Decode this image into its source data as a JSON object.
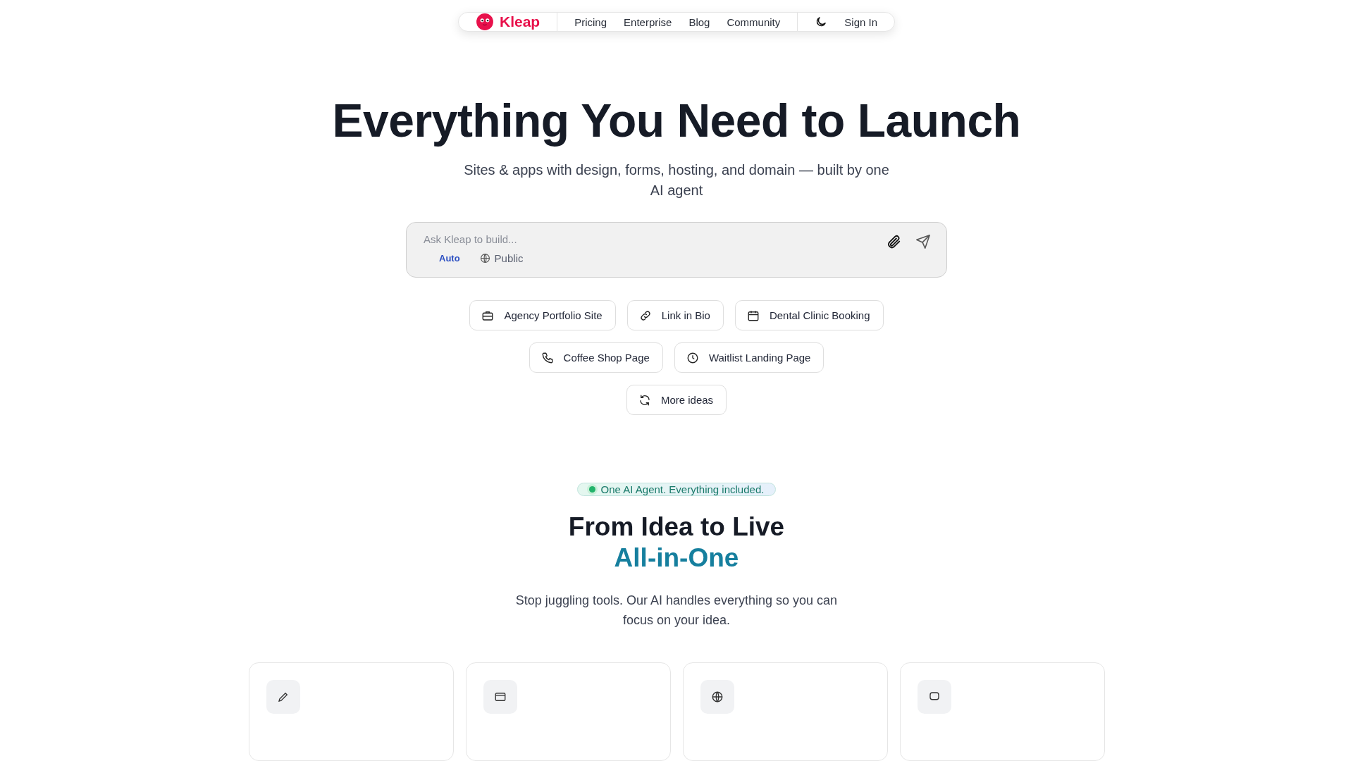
{
  "nav": {
    "brand": "Kleap",
    "links": [
      "Pricing",
      "Enterprise",
      "Blog",
      "Community"
    ],
    "sign_in": "Sign In"
  },
  "hero": {
    "title": "Everything You Need to Launch",
    "subtitle": "Sites & apps with design, forms, hosting, and domain — built by one AI agent"
  },
  "prompt": {
    "placeholder": "Ask Kleap to build...",
    "mode": "Auto",
    "visibility": "Public"
  },
  "suggestions": [
    {
      "kind": "briefcase",
      "label": "Agency Portfolio Site"
    },
    {
      "kind": "link",
      "label": "Link in Bio"
    },
    {
      "kind": "calendar",
      "label": "Dental Clinic Booking"
    },
    {
      "kind": "phone",
      "label": "Coffee Shop Page"
    },
    {
      "kind": "clock",
      "label": "Waitlist Landing Page"
    },
    {
      "kind": "refresh",
      "label": "More ideas"
    }
  ],
  "section": {
    "badge": "One AI Agent. Everything included.",
    "heading": "From Idea to Live",
    "heading_accent": "All-in-One",
    "text": "Stop juggling tools. Our AI handles everything so you can focus on your idea."
  },
  "feature_cards": [
    {
      "kind": "pen"
    },
    {
      "kind": "window"
    },
    {
      "kind": "globe"
    },
    {
      "kind": "chat"
    }
  ]
}
